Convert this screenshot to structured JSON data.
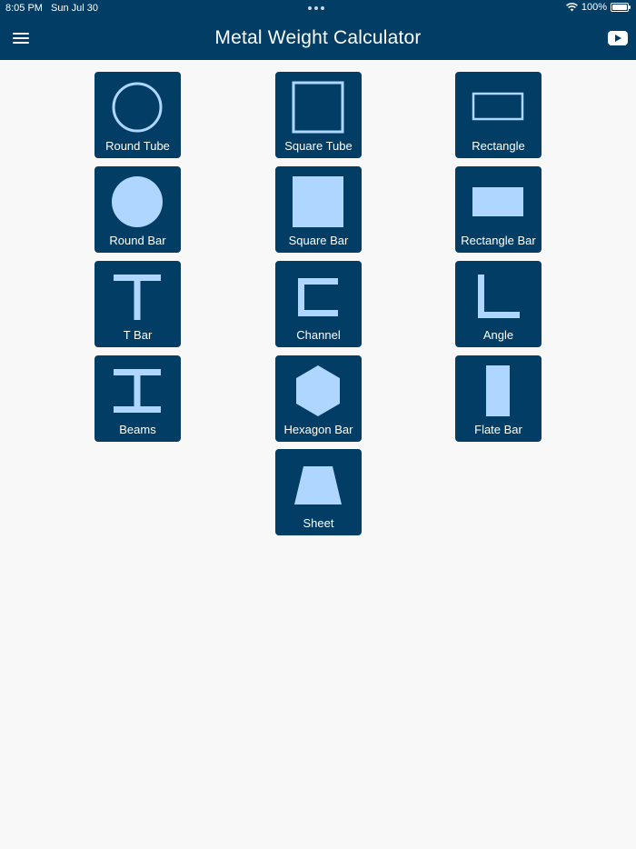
{
  "status": {
    "time": "8:05 PM",
    "date": "Sun Jul 30",
    "battery": "100%",
    "battery_level": 1.0
  },
  "header": {
    "title": "Metal Weight Calculator",
    "menu_icon": "hamburger-menu-icon",
    "video_icon": "youtube-icon"
  },
  "colors": {
    "header_bg": "#013d65",
    "tile_bg": "#013d65",
    "shape_fill": "#aed6fe",
    "page_bg": "#f8f8f8"
  },
  "tiles": [
    {
      "id": "round-tube",
      "label": "Round Tube",
      "icon": "round-tube-icon"
    },
    {
      "id": "square-tube",
      "label": "Square Tube",
      "icon": "square-tube-icon"
    },
    {
      "id": "rectangle",
      "label": "Rectangle",
      "icon": "rectangle-icon"
    },
    {
      "id": "round-bar",
      "label": "Round Bar",
      "icon": "round-bar-icon"
    },
    {
      "id": "square-bar",
      "label": "Square Bar",
      "icon": "square-bar-icon"
    },
    {
      "id": "rectangle-bar",
      "label": "Rectangle Bar",
      "icon": "rectangle-bar-icon"
    },
    {
      "id": "t-bar",
      "label": "T Bar",
      "icon": "t-bar-icon"
    },
    {
      "id": "channel",
      "label": "Channel",
      "icon": "channel-icon"
    },
    {
      "id": "angle",
      "label": "Angle",
      "icon": "angle-icon"
    },
    {
      "id": "beams",
      "label": "Beams",
      "icon": "beam-icon"
    },
    {
      "id": "hexagon-bar",
      "label": "Hexagon Bar",
      "icon": "hexagon-bar-icon"
    },
    {
      "id": "flate-bar",
      "label": "Flate Bar",
      "icon": "flat-bar-icon"
    },
    {
      "id": "sheet",
      "label": "Sheet",
      "icon": "sheet-icon"
    }
  ]
}
